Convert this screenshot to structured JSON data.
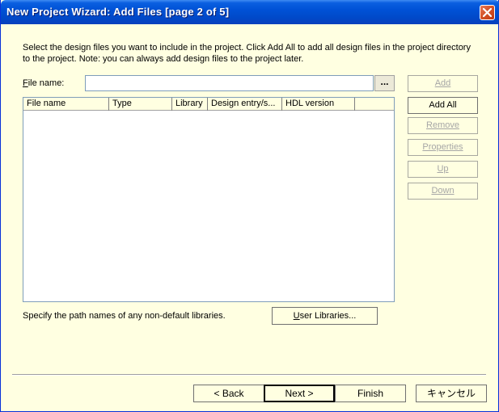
{
  "window": {
    "title": "New Project Wizard: Add Files [page 2 of 5]"
  },
  "description": "Select the design files you want to include in the project. Click Add All to add all design files in the project directory to the project. Note: you can always add design files to the project later.",
  "file_name": {
    "label_prefix": "F",
    "label_rest": "ile name:",
    "value": "",
    "placeholder": "",
    "browse_label": "..."
  },
  "files_table": {
    "columns": [
      "File name",
      "Type",
      "Library",
      "Design entry/s...",
      "HDL version",
      ""
    ],
    "rows": []
  },
  "side_buttons": {
    "add": {
      "label": "Add",
      "enabled": false
    },
    "add_all": {
      "label": "Add All",
      "enabled": true
    },
    "remove": {
      "label": "Remove",
      "enabled": false
    },
    "properties": {
      "label": "Properties",
      "enabled": false
    },
    "up": {
      "label": "Up",
      "enabled": false
    },
    "down": {
      "label": "Down",
      "enabled": false
    }
  },
  "libraries": {
    "note": "Specify the path names of any non-default libraries.",
    "user_libraries_prefix": "U",
    "user_libraries_rest": "ser Libraries..."
  },
  "nav_buttons": {
    "back": "< Back",
    "next": "Next >",
    "finish": "Finish",
    "cancel": "キャンセル"
  },
  "icons": {
    "close": "close-icon"
  }
}
